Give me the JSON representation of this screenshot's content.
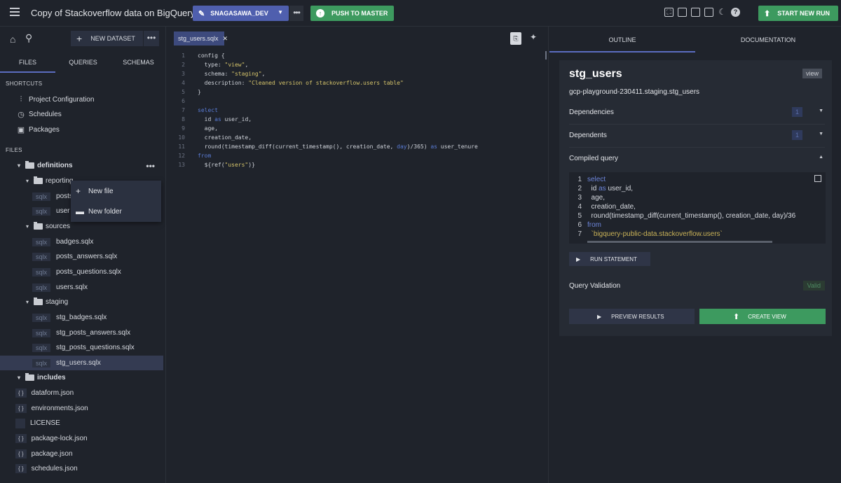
{
  "topbar": {
    "title": "Copy of Stackoverflow data on BigQuery",
    "branch": "SNAGASAWA_DEV",
    "push_label": "PUSH TO MASTER",
    "new_run_label": "START NEW RUN"
  },
  "sidebar": {
    "new_dataset_label": "NEW DATASET",
    "tabs": [
      "FILES",
      "QUERIES",
      "SCHEMAS"
    ],
    "shortcuts_header": "SHORTCUTS",
    "shortcuts": [
      "Project Configuration",
      "Schedules",
      "Packages"
    ],
    "files_header": "FILES",
    "tree": {
      "definitions": "definitions",
      "reporting": "reporting",
      "reporting_files": [
        "posts",
        "user"
      ],
      "sources": "sources",
      "sources_files": [
        "badges.sqlx",
        "posts_answers.sqlx",
        "posts_questions.sqlx",
        "users.sqlx"
      ],
      "staging": "staging",
      "staging_files": [
        "stg_badges.sqlx",
        "stg_posts_answers.sqlx",
        "stg_posts_questions.sqlx",
        "stg_users.sqlx"
      ],
      "includes": "includes",
      "root_files": [
        "dataform.json",
        "environments.json",
        "LICENSE",
        "package-lock.json",
        "package.json",
        "schedules.json"
      ],
      "sqlx_tag": "sqlx",
      "json_tag": "{ }"
    },
    "context_menu": [
      "New file",
      "New folder"
    ]
  },
  "editor": {
    "tab_label": "stg_users.sqlx",
    "line_numbers": [
      "1",
      "2",
      "3",
      "4",
      "5",
      "6",
      "7",
      "8",
      "9",
      "10",
      "11",
      "12",
      "13"
    ]
  },
  "right": {
    "tabs": [
      "OUTLINE",
      "DOCUMENTATION"
    ],
    "title": "stg_users",
    "type_badge": "view",
    "path": "gcp-playground-230411.staging.stg_users",
    "dependencies_label": "Dependencies",
    "dependencies_count": "1",
    "dependents_label": "Dependents",
    "dependents_count": "1",
    "compiled_label": "Compiled query",
    "run_statement_label": "RUN STATEMENT",
    "validation_label": "Query Validation",
    "validation_status": "Valid",
    "preview_label": "PREVIEW RESULTS",
    "create_label": "CREATE VIEW"
  }
}
